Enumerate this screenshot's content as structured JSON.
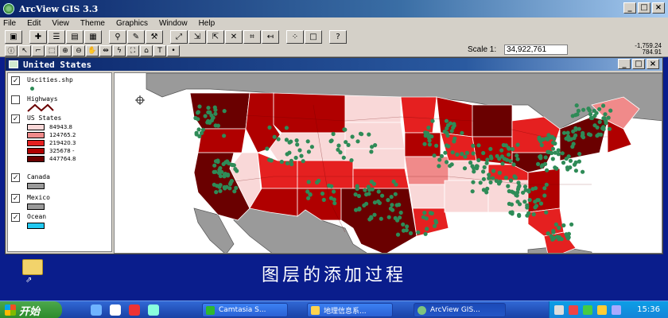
{
  "app": {
    "title": "ArcView GIS 3.3"
  },
  "menu": [
    "File",
    "Edit",
    "View",
    "Theme",
    "Graphics",
    "Window",
    "Help"
  ],
  "toolbar": {
    "scale_label": "Scale 1:",
    "scale_value": "34,922,761",
    "coord_x": "-1,759.24",
    "coord_y": "784.91"
  },
  "view": {
    "title": "United States"
  },
  "toc": {
    "layers": [
      {
        "name": "Uscities.shp",
        "checked": true
      },
      {
        "name": "Highways",
        "checked": false
      },
      {
        "name": "US States",
        "checked": true
      },
      {
        "name": "Canada",
        "checked": true
      },
      {
        "name": "Mexico",
        "checked": true
      },
      {
        "name": "Ocean",
        "checked": true
      }
    ],
    "classes": [
      "84943.8",
      "124765.2",
      "219420.3",
      "325678 -",
      "447764.8"
    ],
    "colors": [
      "#f9d8d8",
      "#f08a8a",
      "#e52020",
      "#b00000",
      "#6a0000"
    ]
  },
  "map_colors": {
    "ocean": "#ffffff",
    "land": "#9a9a9a",
    "cities": "#2e8b57",
    "highway": "#6a0000"
  },
  "subtitle": "图层的添加过程",
  "taskbar": {
    "start": "开始",
    "tasks": [
      "Camtasia S...",
      "地理信息系...",
      "ArcView GIS..."
    ],
    "clock": "15:36"
  }
}
